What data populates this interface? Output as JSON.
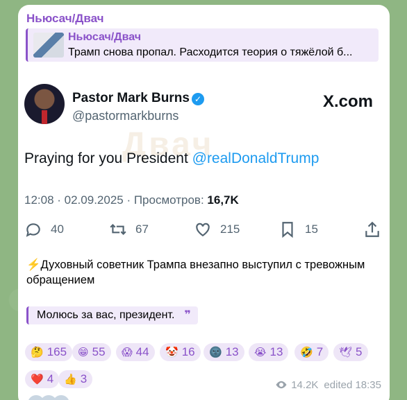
{
  "message": {
    "sender": "Ньюсач/Двач",
    "reply": {
      "title": "Ньюсач/Двач",
      "text": "Трамп снова пропал. Расходится теория о тяжёлой б..."
    },
    "tweet": {
      "author_name": "Pastor Mark Burns",
      "handle": "@pastormarkburns",
      "site": "X.com",
      "watermark": "Двач",
      "text_prefix": "Praying for you President ",
      "mention": "@realDonaldTrump",
      "meta_prefix": "12:08 · 02.09.2025 · Просмотров: ",
      "views": "16,7K",
      "actions": {
        "replies": "40",
        "retweets": "67",
        "likes": "215",
        "bookmarks": "15"
      }
    },
    "text_emoji": "⚡️",
    "text": "Духовный советник Трампа внезапно выступил с тревожным обращением",
    "quote": "Молюсь за вас, президент.",
    "quote_mark": "❞",
    "reactions": [
      {
        "emoji": "🤔",
        "count": "165"
      },
      {
        "emoji": "😁",
        "count": "55"
      },
      {
        "emoji": "😱",
        "count": "44"
      },
      {
        "emoji": "🤡",
        "count": "16"
      },
      {
        "emoji": "🌚",
        "count": "13"
      },
      {
        "emoji": "😭",
        "count": "13"
      },
      {
        "emoji": "🤣",
        "count": "7"
      },
      {
        "emoji": "🕊",
        "count": "5"
      },
      {
        "emoji": "❤️",
        "count": "4"
      },
      {
        "emoji": "👍",
        "count": "3"
      }
    ],
    "views": "14.2K",
    "edited": "edited 18:35"
  },
  "colors": {
    "accent": "#8a52c9",
    "link": "#1d9bf0",
    "background": "#8fb683"
  }
}
